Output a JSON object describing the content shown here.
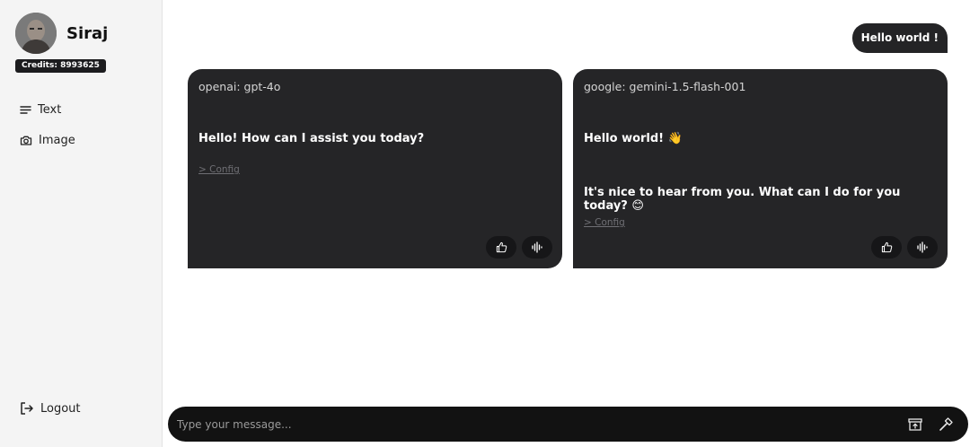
{
  "sidebar": {
    "username": "Siraj",
    "credits": "Credits: 8993625",
    "nav": [
      {
        "label": "Text",
        "icon": "menu-lines-icon"
      },
      {
        "label": "Image",
        "icon": "camera-icon"
      }
    ],
    "logout_label": "Logout"
  },
  "chat": {
    "user_message": "Hello world !",
    "responses": [
      {
        "model": "openai: gpt-4o",
        "paragraphs": [
          "Hello! How can I assist you today?"
        ],
        "config_label": "> Config"
      },
      {
        "model": "google: gemini-1.5-flash-001",
        "paragraphs": [
          "Hello world! 👋",
          "It's nice to hear from you. What can I do for you today? 😊"
        ],
        "config_label": "> Config"
      }
    ]
  },
  "composer": {
    "placeholder": "Type your message..."
  },
  "colors": {
    "sidebar_bg": "#f4f4f4",
    "card_bg": "#252527",
    "composer_bg": "#121212"
  }
}
